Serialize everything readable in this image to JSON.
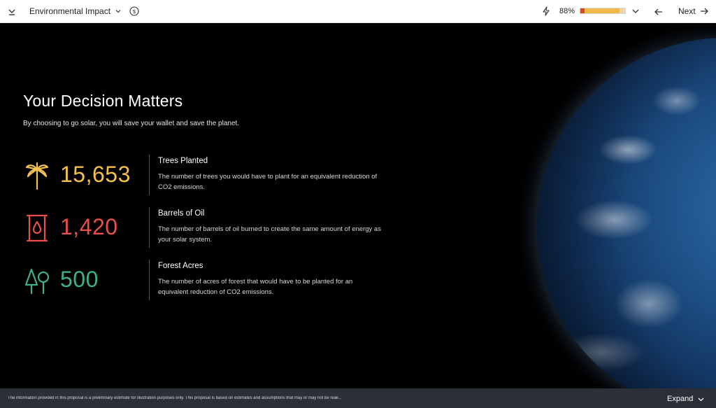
{
  "topbar": {
    "collapse_icon": "chevron-down-line-icon",
    "section_title": "Environmental Impact",
    "progress_percent_label": "88%",
    "progress_value": 0.88,
    "next_label": "Next"
  },
  "main": {
    "headline": "Your Decision Matters",
    "subline": "By choosing to go solar, you will save your wallet and save the planet.",
    "metrics": [
      {
        "icon": "palm-tree-icon",
        "value": "15,653",
        "title": "Trees Planted",
        "description": "The number of trees you would have to plant for an equivalent reduction of CO2 emissions.",
        "color": "#f2c14e"
      },
      {
        "icon": "oil-barrel-icon",
        "value": "1,420",
        "title": "Barrels of Oil",
        "description": "The number of barrels of oil burned to create the same amount of energy as your solar system.",
        "color": "#e8504a"
      },
      {
        "icon": "forest-trees-icon",
        "value": "500",
        "title": "Forest Acres",
        "description": "The number of acres of forest that would have to be planted for an equivalent reduction of CO2 emissions.",
        "color": "#3fb08a"
      }
    ]
  },
  "bottombar": {
    "disclaimer": "The information provided in this proposal is a preliminary estimate for illustration purposes only. This proposal is based on estimates and assumptions that may or may not be reali...",
    "expand_label": "Expand"
  },
  "colors": {
    "progress_fill": "#f0b94a",
    "progress_start": "#d14d1f",
    "bottom_bar": "#2a2f38"
  }
}
